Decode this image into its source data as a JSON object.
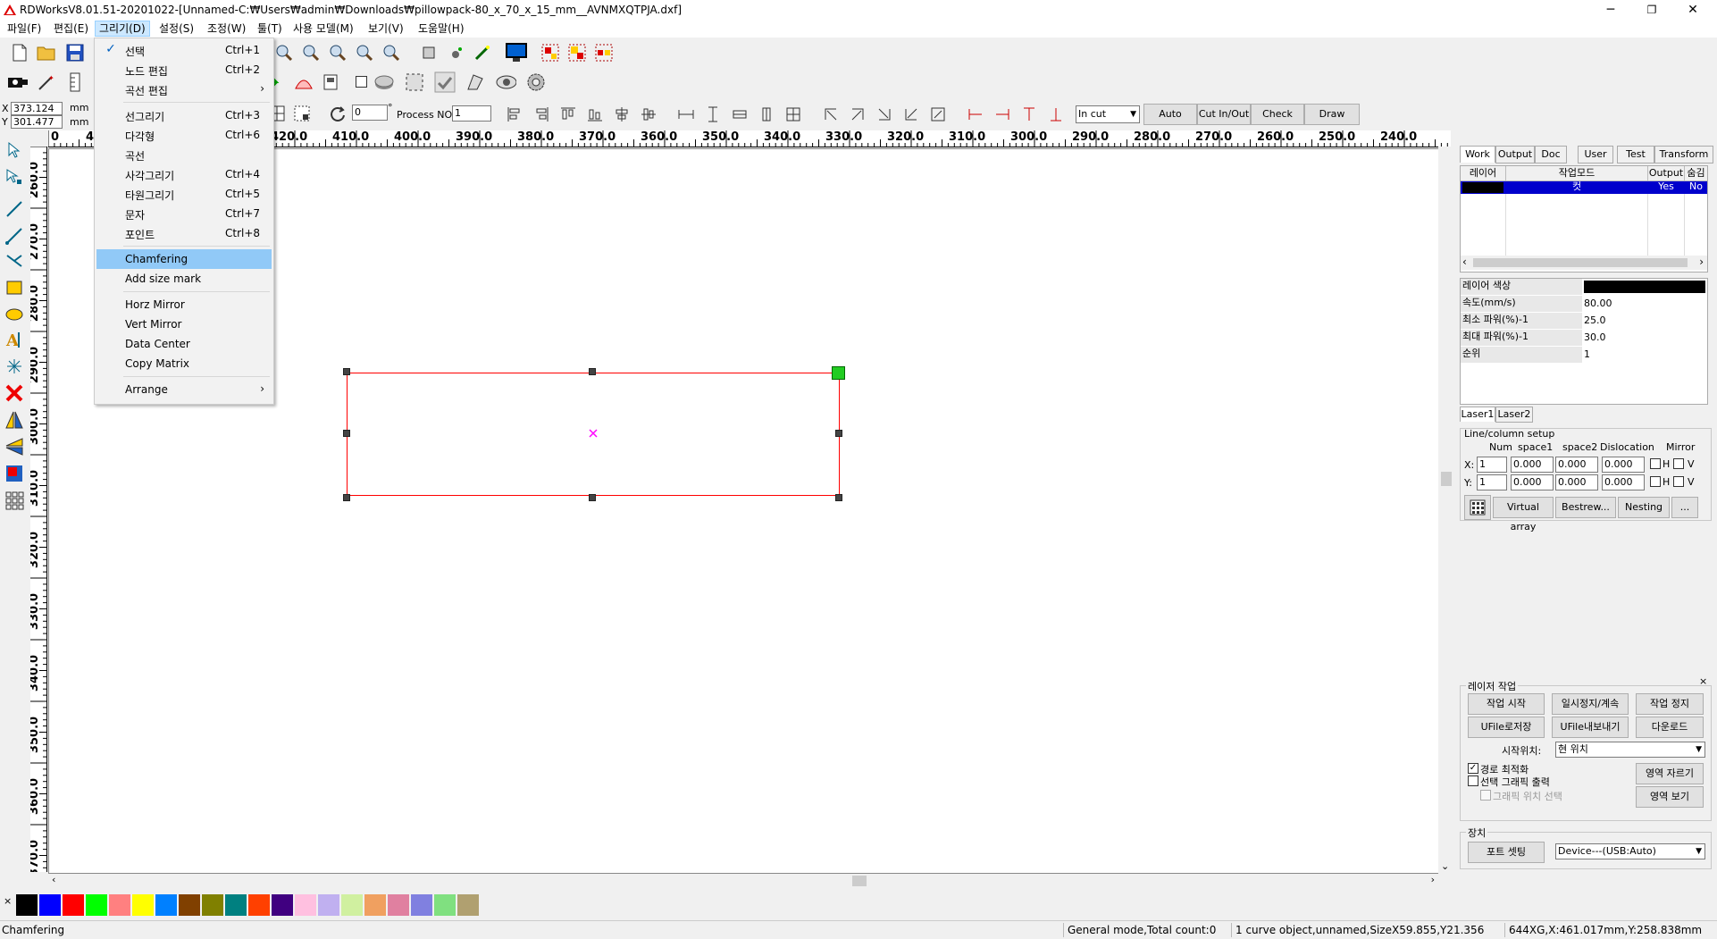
{
  "window": {
    "title": "RDWorksV8.01.51-20201022-[Unnamed-C:₩Users₩admin₩Downloads₩pillowpack-80_x_70_x_15_mm__AVNMXQTPJA.dxf]",
    "minimize": "─",
    "restore": "❐",
    "close": "✕"
  },
  "menubar": [
    "파일(F)",
    "편집(E)",
    "그리기(D)",
    "설정(S)",
    "조정(W)",
    "툴(T)",
    "사용 모델(M)",
    "보기(V)",
    "도움말(H)"
  ],
  "dropdown": {
    "items": [
      {
        "label": "선택",
        "shortcut": "Ctrl+1",
        "checked": "✓"
      },
      {
        "label": "노드 편집",
        "shortcut": "Ctrl+2"
      },
      {
        "label": "곡선 편집",
        "shortcut": "",
        "arrow": "›"
      },
      {
        "label": "선그리기",
        "shortcut": "Ctrl+3"
      },
      {
        "label": "다각형",
        "shortcut": "Ctrl+6"
      },
      {
        "label": "곡선",
        "shortcut": ""
      },
      {
        "label": "사각그리기",
        "shortcut": "Ctrl+4"
      },
      {
        "label": "타원그리기",
        "shortcut": "Ctrl+5"
      },
      {
        "label": "문자",
        "shortcut": "Ctrl+7"
      },
      {
        "label": "포인트",
        "shortcut": "Ctrl+8"
      },
      {
        "label": "Chamfering",
        "shortcut": ""
      },
      {
        "label": "Add size mark",
        "shortcut": ""
      },
      {
        "label": "Horz Mirror",
        "shortcut": ""
      },
      {
        "label": "Vert Mirror",
        "shortcut": ""
      },
      {
        "label": "Data Center",
        "shortcut": ""
      },
      {
        "label": "Copy Matrix",
        "shortcut": ""
      },
      {
        "label": "Arrange",
        "shortcut": "",
        "arrow": "›"
      }
    ]
  },
  "coords": {
    "x_label": "X",
    "y_label": "Y",
    "x_value": "373.124",
    "y_value": "301.477",
    "unit": "mm"
  },
  "toolbar3": {
    "angle_value": "0",
    "degree": "°",
    "process_label": "Process NO:",
    "process_value": "1",
    "cut_mode": "In cut",
    "auto": "Auto",
    "cut_in_out": "Cut In/Out",
    "check": "Check",
    "draw": "Draw"
  },
  "ruler": {
    "top": [
      "0",
      "4",
      "420.0",
      "410.0",
      "400.0",
      "390.0",
      "380.0",
      "370.0",
      "360.0",
      "350.0",
      "340.0",
      "330.0",
      "320.0",
      "310.0",
      "300.0",
      "290.0",
      "280.0",
      "270.0",
      "260.0",
      "250.0",
      "240.0"
    ],
    "left": [
      "260.0",
      "270.0",
      "280.0",
      "290.0",
      "300.0",
      "310.0",
      "320.0",
      "330.0",
      "340.0",
      "350.0",
      "360.0",
      "370.0"
    ]
  },
  "panel": {
    "tabs": [
      "Work",
      "Output",
      "Doc",
      "User",
      "Test",
      "Transform"
    ],
    "layer_headers": [
      "레이어",
      "작업모드",
      "Output",
      "숨김"
    ],
    "layer_row": {
      "mode": "컷",
      "output": "Yes",
      "hide": "No"
    },
    "props": [
      {
        "name": "레이어 색상",
        "value": ""
      },
      {
        "name": "속도(mm/s)",
        "value": "80.00"
      },
      {
        "name": "최소 파워(%)-1",
        "value": "25.0"
      },
      {
        "name": "최대 파워(%)-1",
        "value": "30.0"
      },
      {
        "name": "순위",
        "value": "1"
      }
    ],
    "laser_tabs": [
      "Laser1",
      "Laser2"
    ],
    "array": {
      "group_title": "Line/column setup",
      "headers": [
        "Num",
        "space1",
        "space2",
        "Dislocation",
        "Mirror"
      ],
      "x_label": "X:",
      "y_label": "Y:",
      "x_num": "1",
      "x_space1": "0.000",
      "x_space2": "0.000",
      "x_disloc": "0.000",
      "y_num": "1",
      "y_space1": "0.000",
      "y_space2": "0.000",
      "y_disloc": "0.000",
      "h": "H",
      "v": "V",
      "virtual_array": "Virtual array",
      "bestrew": "Bestrew...",
      "nesting": "Nesting",
      "more": "..."
    }
  },
  "laser_work": {
    "title": "레이저 작업",
    "start": "작업 시작",
    "pause": "일시정지/계속",
    "stop": "작업 정지",
    "ufile_save": "UFile로저장",
    "ufile_export": "UFile내보내기",
    "download": "다운로드",
    "start_pos_label": "시작위치:",
    "start_pos_value": "현 위치",
    "opt_path": "경로 최적화",
    "opt_selected": "선택 그래픽 출력",
    "opt_graphic_pos": "그래픽 위치 선택",
    "area_cut": "영역 자르기",
    "area_view": "영역 보기",
    "device_title": "장치",
    "port_setting": "포트 셋팅",
    "device_value": "Device---(USB:Auto)"
  },
  "palette": [
    "#000000",
    "#0000ff",
    "#ff0000",
    "#00ff00",
    "#ff8080",
    "#ffff00",
    "#0080ff",
    "#804000",
    "#808000",
    "#008080",
    "#ff4000",
    "#400080",
    "#ffc0e0",
    "#c0b0f0",
    "#d0f0a0",
    "#f0a060",
    "#e080a0",
    "#8080e0",
    "#80e080",
    "#b0a070"
  ],
  "status": {
    "left": "Chamfering",
    "mode": "General mode,Total count:0",
    "object": "1 curve object,unnamed,SizeX59.855,Y21.356",
    "position": "644XG,X:461.017mm,Y:258.838mm"
  },
  "colors": {
    "accent": "#91c9f7",
    "selected_row": "#0000cc",
    "shape_stroke": "#ff0000",
    "center_mark": "#ff00ff",
    "anchor": "#00cc00"
  }
}
